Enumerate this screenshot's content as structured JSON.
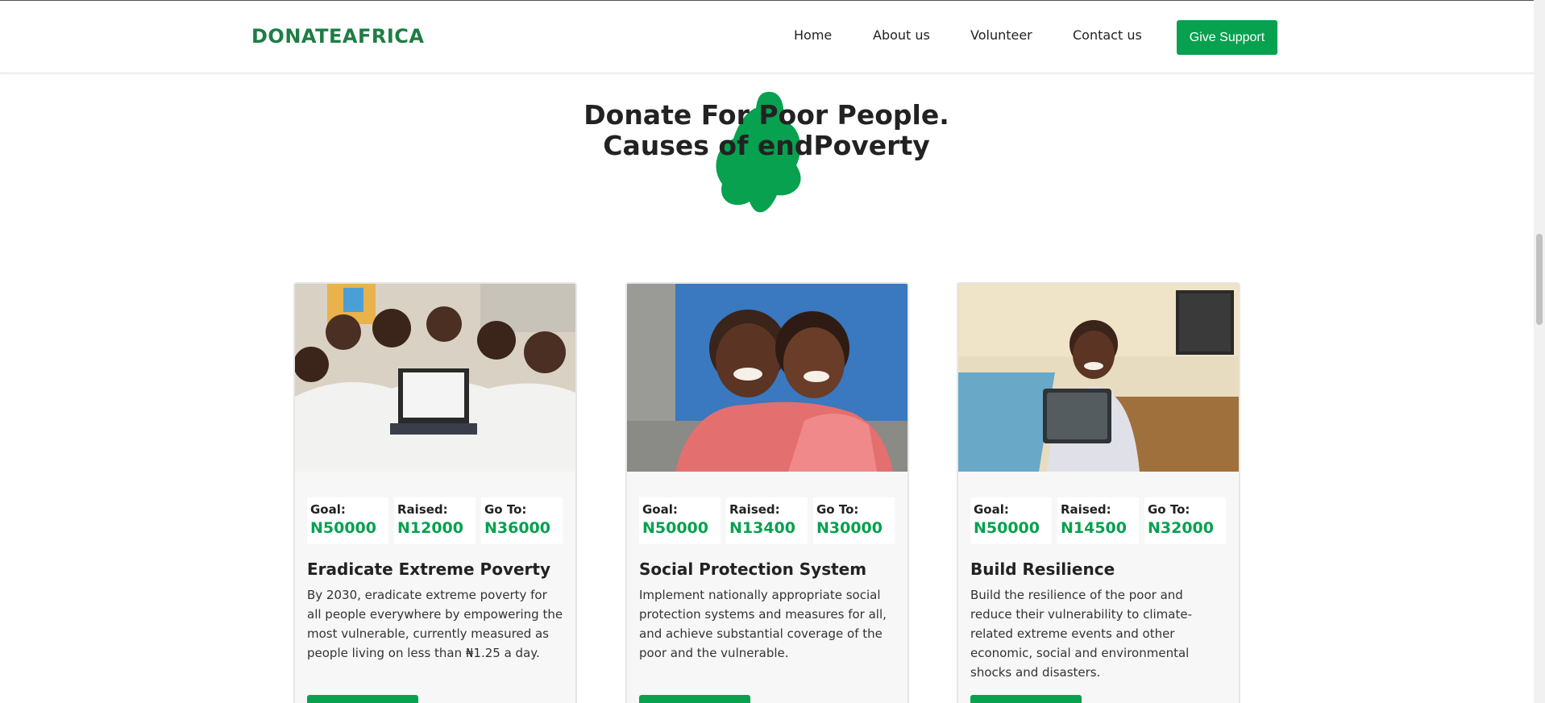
{
  "brand": "DONATEAFRICA",
  "nav": {
    "items": [
      {
        "label": "Home"
      },
      {
        "label": "About us"
      },
      {
        "label": "Volunteer"
      },
      {
        "label": "Contact us"
      }
    ],
    "cta": "Give Support"
  },
  "hero": {
    "line1": "Donate For Poor People.",
    "line2": "Causes of endPoverty"
  },
  "colors": {
    "accent": "#07a14f",
    "brand": "#1e7d44"
  },
  "cards": [
    {
      "image": "children-with-laptop-photo",
      "stats": [
        {
          "label": "Goal:",
          "value": "N50000"
        },
        {
          "label": "Raised:",
          "value": "N12000"
        },
        {
          "label": "Go To:",
          "value": "N36000"
        }
      ],
      "title": "Eradicate Extreme Poverty",
      "text": "By 2030, eradicate extreme poverty for all people everywhere by empowering the most vulnerable, currently measured as people living on less than ₦1.25 a day."
    },
    {
      "image": "two-girls-hugging-photo",
      "stats": [
        {
          "label": "Goal:",
          "value": "N50000"
        },
        {
          "label": "Raised:",
          "value": "N13400"
        },
        {
          "label": "Go To:",
          "value": "N30000"
        }
      ],
      "title": "Social Protection System",
      "text": "Implement nationally appropriate social protection systems and measures for all, and achieve substantial coverage of the poor and the vulnerable."
    },
    {
      "image": "girl-with-slate-photo",
      "stats": [
        {
          "label": "Goal:",
          "value": "N50000"
        },
        {
          "label": "Raised:",
          "value": "N14500"
        },
        {
          "label": "Go To:",
          "value": "N32000"
        }
      ],
      "title": "Build Resilience",
      "text": "Build the resilience of the poor and reduce their vulnerability to climate-related extreme events and other economic, social and environmental shocks and disasters."
    }
  ]
}
